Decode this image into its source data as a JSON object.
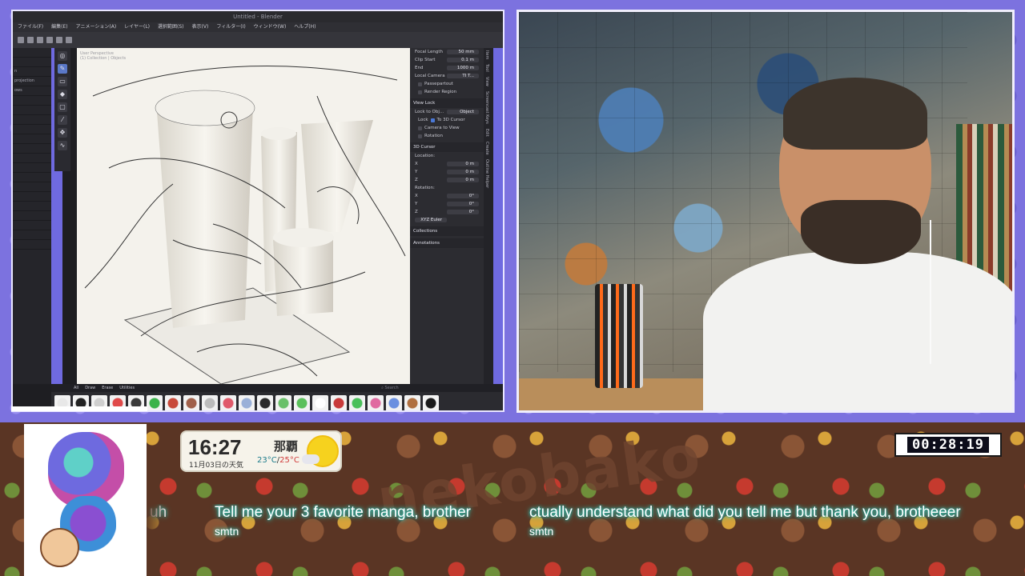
{
  "app": {
    "title": "Untitled - Blender",
    "menu": [
      "ファイル(F)",
      "編集(E)",
      "アニメーション(A)",
      "レイヤー(L)",
      "選択範囲(S)",
      "表示(V)",
      "フィルター(I)",
      "ウィンドウ(W)",
      "ヘルプ(H)"
    ],
    "layers": [
      "",
      "",
      "n",
      "projection",
      "ows",
      "",
      "",
      "",
      "",
      "",
      "",
      "",
      "",
      "",
      "",
      "",
      "",
      "",
      "",
      "",
      ""
    ],
    "canvas_caption": [
      "User Perspective",
      "(1) Collection | Objects"
    ],
    "tools": [
      "cursor",
      "brush",
      "eraser",
      "fill",
      "frame",
      "eyedropper",
      "transform",
      "curve"
    ],
    "view_panel": {
      "focal_length_label": "Focal Length",
      "focal_length_value": "50 mm",
      "clip_start_label": "Clip Start",
      "clip_start_value": "0.1 m",
      "end_label": "End",
      "end_value": "1000 m",
      "local_camera_label": "Local Camera",
      "local_camera_value": "TI T...",
      "passepartout_label": "Passepartout",
      "render_region_label": "Render Region",
      "view_lock_header": "View Lock",
      "lock_to_object_label": "Lock to Obj...",
      "lock_to_object_value": "Object",
      "lock_label": "Lock",
      "to_3d_cursor_label": "To 3D Cursor",
      "camera_to_view_label": "Camera to View",
      "rotation_label": "Rotation",
      "cursor_header": "3D Cursor",
      "location_label": "Location:",
      "loc_x": "0 m",
      "loc_y": "0 m",
      "loc_z": "0 m",
      "rotation_section_label": "Rotation:",
      "rot_x": "0°",
      "rot_y": "0°",
      "rot_z": "0°",
      "rotation_mode": "XYZ Euler",
      "collections_header": "Collections",
      "annotations_header": "Annotations"
    },
    "side_tabs": [
      "Item",
      "Tool",
      "View",
      "Screencast Keys",
      "Edit",
      "Create",
      "Outline Helper"
    ],
    "brush_tabs": [
      "All",
      "Draw",
      "Erase",
      "Utilities"
    ],
    "brush_search_placeholder": "Search",
    "brush_colors": [
      "#e8e8e8",
      "#222222",
      "#cfcfcf",
      "#e04a4a",
      "#3a3a3a",
      "#3ab34a",
      "#c84a3a",
      "#a0604a",
      "#bcbcbc",
      "#e05a6a",
      "#9ab0d8",
      "#2a2a2a",
      "#6ac06a",
      "#5ac05a",
      "#ffffff",
      "#c83a3a",
      "#4ac05a",
      "#e06aa0",
      "#6a90e0",
      "#b07040",
      "#1a1a1a"
    ]
  },
  "overlay": {
    "clock": "16:27",
    "date": "11月03日の天気",
    "city": "那覇",
    "temp_low": "23°C",
    "temp_sep": "/",
    "temp_high": "25°C",
    "weather_icon": "sun-with-cloud-icon",
    "timer": "00:28:19",
    "chat": [
      {
        "text": "uh",
        "user": ""
      },
      {
        "text": "Tell me your 3 favorite manga, brother",
        "user": "smtn"
      },
      {
        "text": "ctually understand what did you tell me but thank you, brotheeer",
        "user": "smtn"
      }
    ]
  },
  "colors": {
    "frame_purple": "#7c72df",
    "chat_glow": "#49e0d0",
    "timer_bg": "#0d0d1a"
  }
}
